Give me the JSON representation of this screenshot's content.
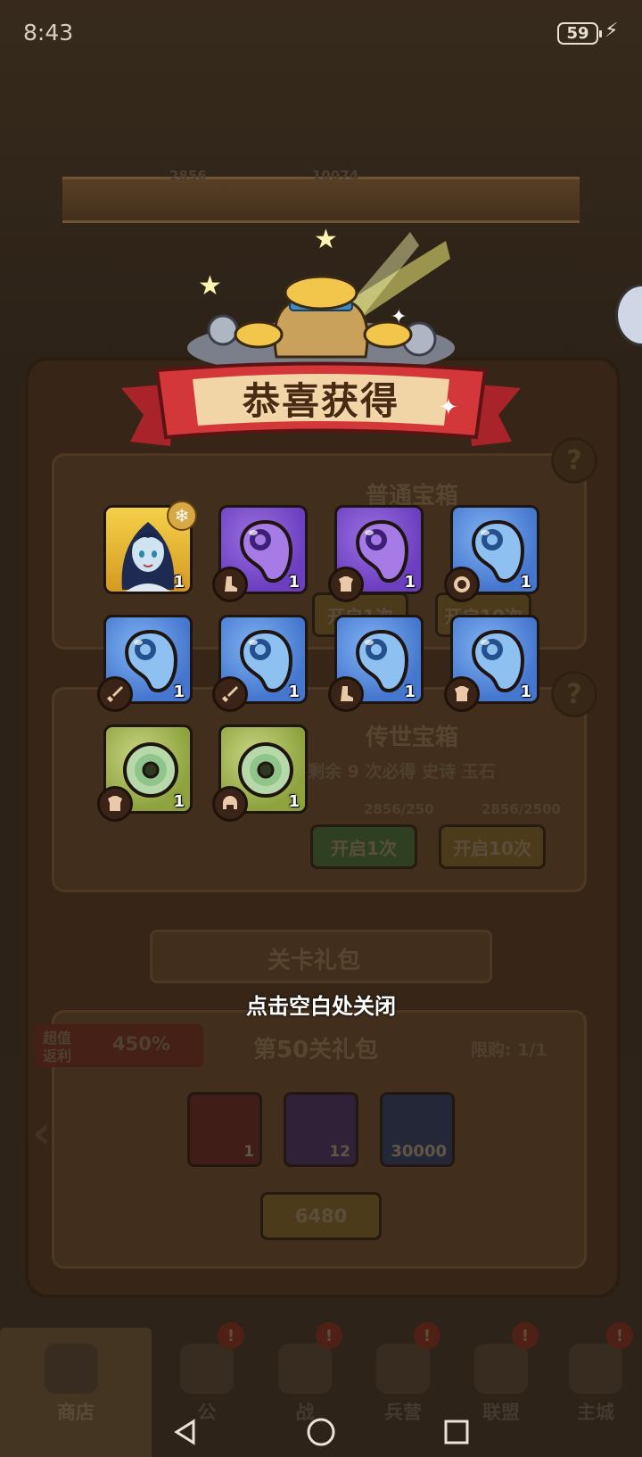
{
  "status_bar": {
    "time": "8:43",
    "battery": "59"
  },
  "background": {
    "res1": "2856",
    "res2": "10074",
    "box_normal_title": "普通宝箱",
    "btn_open1_a": "开启1次",
    "btn_open10_a": "开启10次",
    "box_legend_title": "传世宝箱",
    "box_legend_desc": "剩余 9 次必得 史诗 玉石",
    "cost1": "2856/250",
    "cost10": "2856/2500",
    "btn_open1_b": "开启1次",
    "btn_open10_b": "开启10次",
    "stage_pack_header": "关卡礼包",
    "value_badge_line1": "超值",
    "value_badge_line2": "返利",
    "value_percent": "450%",
    "pack_title": "第50关礼包",
    "limit": "限购: 1/1",
    "pack_items": [
      "1",
      "12",
      "30000"
    ],
    "price": "6480"
  },
  "popup": {
    "title": "恭喜获得",
    "close_hint": "点击空白处关闭",
    "rewards": [
      {
        "type": "hero",
        "qty": "1"
      },
      {
        "type": "purple",
        "slot": "boots-icon",
        "qty": "1"
      },
      {
        "type": "purple",
        "slot": "armor-icon",
        "qty": "1"
      },
      {
        "type": "blue",
        "slot": "ring-icon",
        "qty": "1"
      },
      {
        "type": "blue",
        "slot": "sword-icon",
        "qty": "1"
      },
      {
        "type": "blue",
        "slot": "sword-icon",
        "qty": "1"
      },
      {
        "type": "blue",
        "slot": "boots-icon",
        "qty": "1"
      },
      {
        "type": "blue",
        "slot": "armor-icon",
        "qty": "1"
      },
      {
        "type": "green",
        "slot": "armor-icon",
        "qty": "1"
      },
      {
        "type": "green",
        "slot": "helmet-icon",
        "qty": "1"
      }
    ]
  },
  "tabs": [
    {
      "label": "商店",
      "active": true
    },
    {
      "label": "公",
      "alert": "!"
    },
    {
      "label": "战",
      "alert": "!"
    },
    {
      "label": "兵营",
      "alert": "!"
    },
    {
      "label": "联盟",
      "alert": "!"
    },
    {
      "label": "主城",
      "alert": "!"
    }
  ],
  "colors": {
    "ribbon": "#d3373a",
    "ribbon_center": "#f1d5a6",
    "gold": "#e9b83a"
  }
}
